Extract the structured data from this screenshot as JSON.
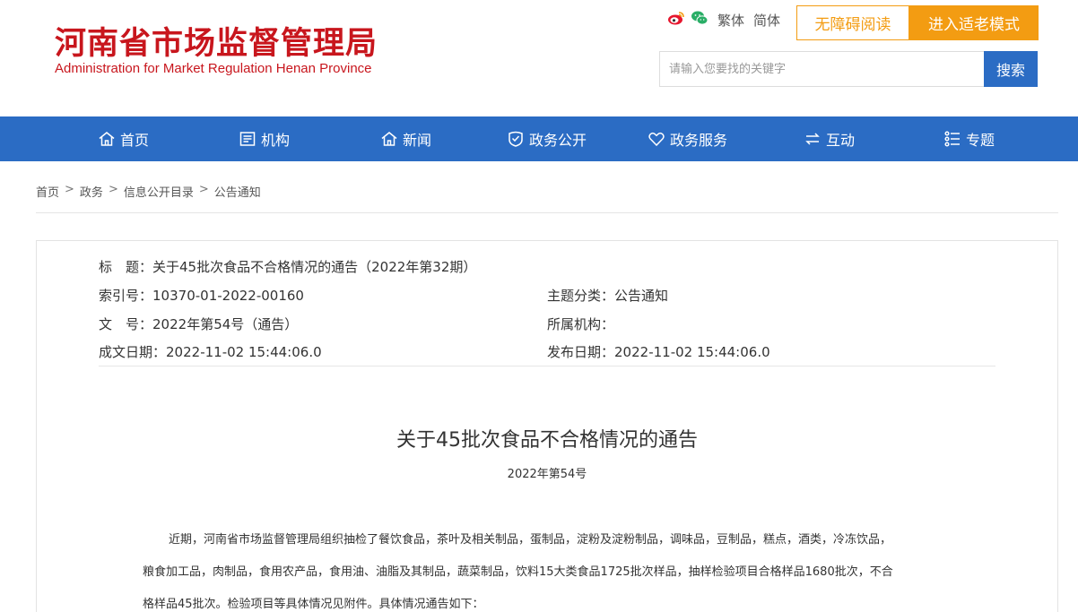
{
  "header": {
    "logo_cn": "河南省市场监督管理局",
    "logo_en": "Administration for Market Regulation Henan Province",
    "lang_traditional": "繁体",
    "lang_simplified": "简体",
    "accessible_reading": "无障碍阅读",
    "elder_mode": "进入适老模式",
    "search_placeholder": "请输入您要找的关键字",
    "search_button": "搜索",
    "accent_color": "#f39c12",
    "brand_red": "#c8161d"
  },
  "nav": {
    "color": "#2b6cc4",
    "items": [
      {
        "label": "首页",
        "icon": "home-icon"
      },
      {
        "label": "机构",
        "icon": "organization-icon"
      },
      {
        "label": "新闻",
        "icon": "news-icon"
      },
      {
        "label": "政务公开",
        "icon": "open-government-icon"
      },
      {
        "label": "政务服务",
        "icon": "heart-service-icon"
      },
      {
        "label": "互动",
        "icon": "interaction-icon"
      },
      {
        "label": "专题",
        "icon": "topic-icon"
      }
    ]
  },
  "breadcrumb": {
    "items": [
      "首页",
      "政务",
      "信息公开目录",
      "公告通知"
    ],
    "separator": ">"
  },
  "meta": {
    "title_label": "标　题：",
    "title_value": "关于45批次食品不合格情况的通告（2022年第32期）",
    "index_label": "索引号：",
    "index_value": "10370-01-2022-00160",
    "topic_label": "主题分类：",
    "topic_value": "公告通知",
    "doc_label": "文　号：",
    "doc_value": "2022年第54号（通告）",
    "org_label": "所属机构：",
    "org_value": "",
    "created_label": "成文日期：",
    "created_value": "2022-11-02 15:44:06.0",
    "published_label": "发布日期：",
    "published_value": "2022-11-02 15:44:06.0"
  },
  "article": {
    "title": "关于45批次食品不合格情况的通告",
    "number": "2022年第54号",
    "paragraph_lines": [
      "近期，河南省市场监督管理局组织抽检了餐饮食品，茶叶及相关制品，蛋制品，淀粉及淀粉制品，调味品，豆制品，糕点，酒类，冷冻饮品，",
      "粮食加工品，肉制品，食用农产品，食用油、油脂及其制品，蔬菜制品，饮料15大类食品1725批次样品，抽样检验项目合格样品1680批次，不合",
      "格样品45批次。检验项目等具体情况见附件。具体情况通告如下："
    ]
  }
}
